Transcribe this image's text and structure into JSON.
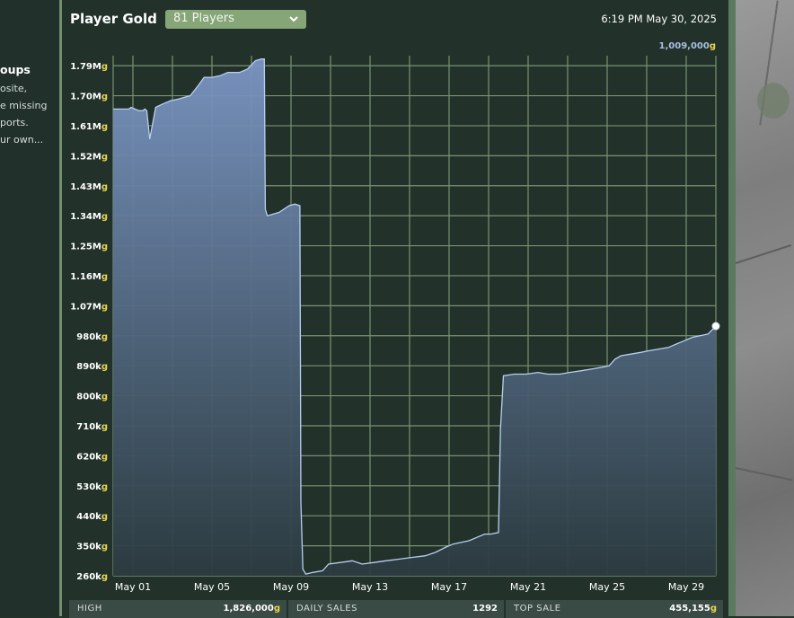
{
  "left_panel": {
    "title": "oups",
    "lines": [
      "osite,",
      "e missing",
      "ports.",
      "ur own..."
    ]
  },
  "header": {
    "title": "Player Gold",
    "players_select": "81 Players",
    "datetime": "6:19 PM May 30, 2025",
    "current_value": "1,009,000",
    "current_unit": "g"
  },
  "colors": {
    "line": "#b9cff0",
    "fill_top": "#7b96c4",
    "fill_bottom": "#2b3b40",
    "grid": "#7a9272",
    "gold_unit": "#e8d64a"
  },
  "chart_data": {
    "type": "area",
    "title": "Player Gold",
    "xlabel": "",
    "ylabel": "",
    "ylim": [
      260000,
      1820000
    ],
    "xlim_days": [
      0.0,
      30.5
    ],
    "grid": true,
    "legend": "none",
    "y_ticks": [
      {
        "num": "260",
        "unit": "kg",
        "value": 260000
      },
      {
        "num": "350",
        "unit": "kg",
        "value": 350000
      },
      {
        "num": "440",
        "unit": "kg",
        "value": 440000
      },
      {
        "num": "530",
        "unit": "kg",
        "value": 530000
      },
      {
        "num": "620",
        "unit": "kg",
        "value": 620000
      },
      {
        "num": "710",
        "unit": "kg",
        "value": 710000
      },
      {
        "num": "800",
        "unit": "kg",
        "value": 800000
      },
      {
        "num": "890",
        "unit": "kg",
        "value": 890000
      },
      {
        "num": "980",
        "unit": "kg",
        "value": 980000
      },
      {
        "num": "1.07",
        "unit": "Mg",
        "value": 1070000
      },
      {
        "num": "1.16",
        "unit": "Mg",
        "value": 1160000
      },
      {
        "num": "1.25",
        "unit": "Mg",
        "value": 1250000
      },
      {
        "num": "1.34",
        "unit": "Mg",
        "value": 1340000
      },
      {
        "num": "1.43",
        "unit": "Mg",
        "value": 1430000
      },
      {
        "num": "1.52",
        "unit": "Mg",
        "value": 1520000
      },
      {
        "num": "1.61",
        "unit": "Mg",
        "value": 1610000
      },
      {
        "num": "1.70",
        "unit": "Mg",
        "value": 1700000
      },
      {
        "num": "1.79",
        "unit": "Mg",
        "value": 1790000
      }
    ],
    "x_ticks": [
      {
        "label": "May 01",
        "day": 1
      },
      {
        "label": "May 05",
        "day": 5
      },
      {
        "label": "May 09",
        "day": 9
      },
      {
        "label": "May 13",
        "day": 13
      },
      {
        "label": "May 17",
        "day": 17
      },
      {
        "label": "May 21",
        "day": 21
      },
      {
        "label": "May 25",
        "day": 25
      },
      {
        "label": "May 29",
        "day": 29
      }
    ],
    "series": [
      {
        "points": [
          [
            0.0,
            1660000
          ],
          [
            0.8,
            1660000
          ],
          [
            0.9,
            1665000
          ],
          [
            1.1,
            1660000
          ],
          [
            1.3,
            1655000
          ],
          [
            1.5,
            1655000
          ],
          [
            1.6,
            1660000
          ],
          [
            1.7,
            1655000
          ],
          [
            1.85,
            1570000
          ],
          [
            2.15,
            1665000
          ],
          [
            2.5,
            1675000
          ],
          [
            2.9,
            1685000
          ],
          [
            3.3,
            1690000
          ],
          [
            3.6,
            1695000
          ],
          [
            3.9,
            1700000
          ],
          [
            4.3,
            1730000
          ],
          [
            4.6,
            1755000
          ],
          [
            5.0,
            1755000
          ],
          [
            5.4,
            1760000
          ],
          [
            5.8,
            1770000
          ],
          [
            6.4,
            1770000
          ],
          [
            6.8,
            1780000
          ],
          [
            7.2,
            1805000
          ],
          [
            7.5,
            1810000
          ],
          [
            7.65,
            1810000
          ],
          [
            7.7,
            1360000
          ],
          [
            7.8,
            1340000
          ],
          [
            8.4,
            1350000
          ],
          [
            8.9,
            1370000
          ],
          [
            9.2,
            1375000
          ],
          [
            9.45,
            1370000
          ],
          [
            9.5,
            480000
          ],
          [
            9.6,
            280000
          ],
          [
            9.75,
            265000
          ],
          [
            10.1,
            270000
          ],
          [
            10.6,
            275000
          ],
          [
            10.9,
            295000
          ],
          [
            11.5,
            300000
          ],
          [
            12.1,
            305000
          ],
          [
            12.6,
            295000
          ],
          [
            13.2,
            300000
          ],
          [
            13.8,
            305000
          ],
          [
            14.5,
            310000
          ],
          [
            15.1,
            315000
          ],
          [
            15.8,
            320000
          ],
          [
            16.3,
            330000
          ],
          [
            16.8,
            345000
          ],
          [
            17.2,
            355000
          ],
          [
            17.6,
            360000
          ],
          [
            18.0,
            365000
          ],
          [
            18.4,
            375000
          ],
          [
            18.8,
            385000
          ],
          [
            19.1,
            385000
          ],
          [
            19.5,
            390000
          ],
          [
            19.6,
            700000
          ],
          [
            19.75,
            860000
          ],
          [
            20.3,
            865000
          ],
          [
            20.9,
            865000
          ],
          [
            21.5,
            870000
          ],
          [
            22.0,
            865000
          ],
          [
            22.6,
            865000
          ],
          [
            23.1,
            870000
          ],
          [
            23.7,
            875000
          ],
          [
            24.2,
            880000
          ],
          [
            24.7,
            885000
          ],
          [
            25.1,
            890000
          ],
          [
            25.4,
            910000
          ],
          [
            25.7,
            920000
          ],
          [
            26.2,
            925000
          ],
          [
            26.7,
            930000
          ],
          [
            27.1,
            935000
          ],
          [
            27.6,
            940000
          ],
          [
            28.1,
            945000
          ],
          [
            28.5,
            955000
          ],
          [
            28.9,
            965000
          ],
          [
            29.3,
            975000
          ],
          [
            29.7,
            980000
          ],
          [
            30.1,
            985000
          ],
          [
            30.5,
            1009000
          ]
        ]
      }
    ],
    "last_point_marker": true
  },
  "stats": [
    {
      "label": "HIGH",
      "value": "1,826,000",
      "unit": "g"
    },
    {
      "label": "DAILY SALES",
      "value": "1292",
      "unit": ""
    },
    {
      "label": "TOP SALE",
      "value": "455,155",
      "unit": "g"
    }
  ]
}
